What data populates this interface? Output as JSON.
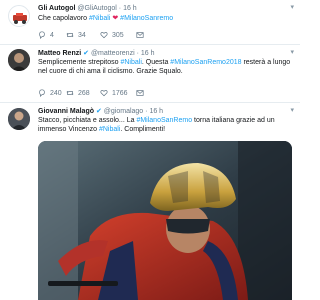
{
  "tweets": [
    {
      "name": "Gli Autogol",
      "handle": "@GliAutogol",
      "sep": "·",
      "time": "16 h",
      "text_prefix": "Che capolavoro ",
      "tag1": "#Nibali",
      "heart": "❤",
      "tag2": "#MilanoSanremo",
      "counts": {
        "reply": "4",
        "retweet": "34",
        "like": "305"
      }
    },
    {
      "name": "Matteo Renzi",
      "handle": "@matteorenzi",
      "sep": "·",
      "time": "16 h",
      "text_a": "Semplicemente strepitoso ",
      "tag1": "#Nibali",
      "text_b": ". Questa ",
      "tag2": "#MilanoSanRemo2018",
      "text_c": " resterà a lungo nel cuore di chi ama il ciclismo. Grazie Squalo.",
      "counts": {
        "reply": "240",
        "retweet": "268",
        "like": "1766"
      }
    },
    {
      "name": "Giovanni Malagò",
      "handle": "@giomalago",
      "sep": "·",
      "time": "16 h",
      "text_a": "Stacco, picchiata e assolo... La ",
      "tag1": "#MilanoSanRemo",
      "text_b": " torna italiana grazie ad un immenso Vincenzo ",
      "tag2": "#Nibali",
      "text_c": ". Complimenti!"
    }
  ],
  "icons": {
    "reply": "reply-icon",
    "retweet": "retweet-icon",
    "like": "heart-icon",
    "dm": "direct-message-icon",
    "caret": "chevron-down-icon"
  },
  "colors": {
    "link": "#1da1f2",
    "heart": "#e0245e",
    "muted": "#657786"
  }
}
